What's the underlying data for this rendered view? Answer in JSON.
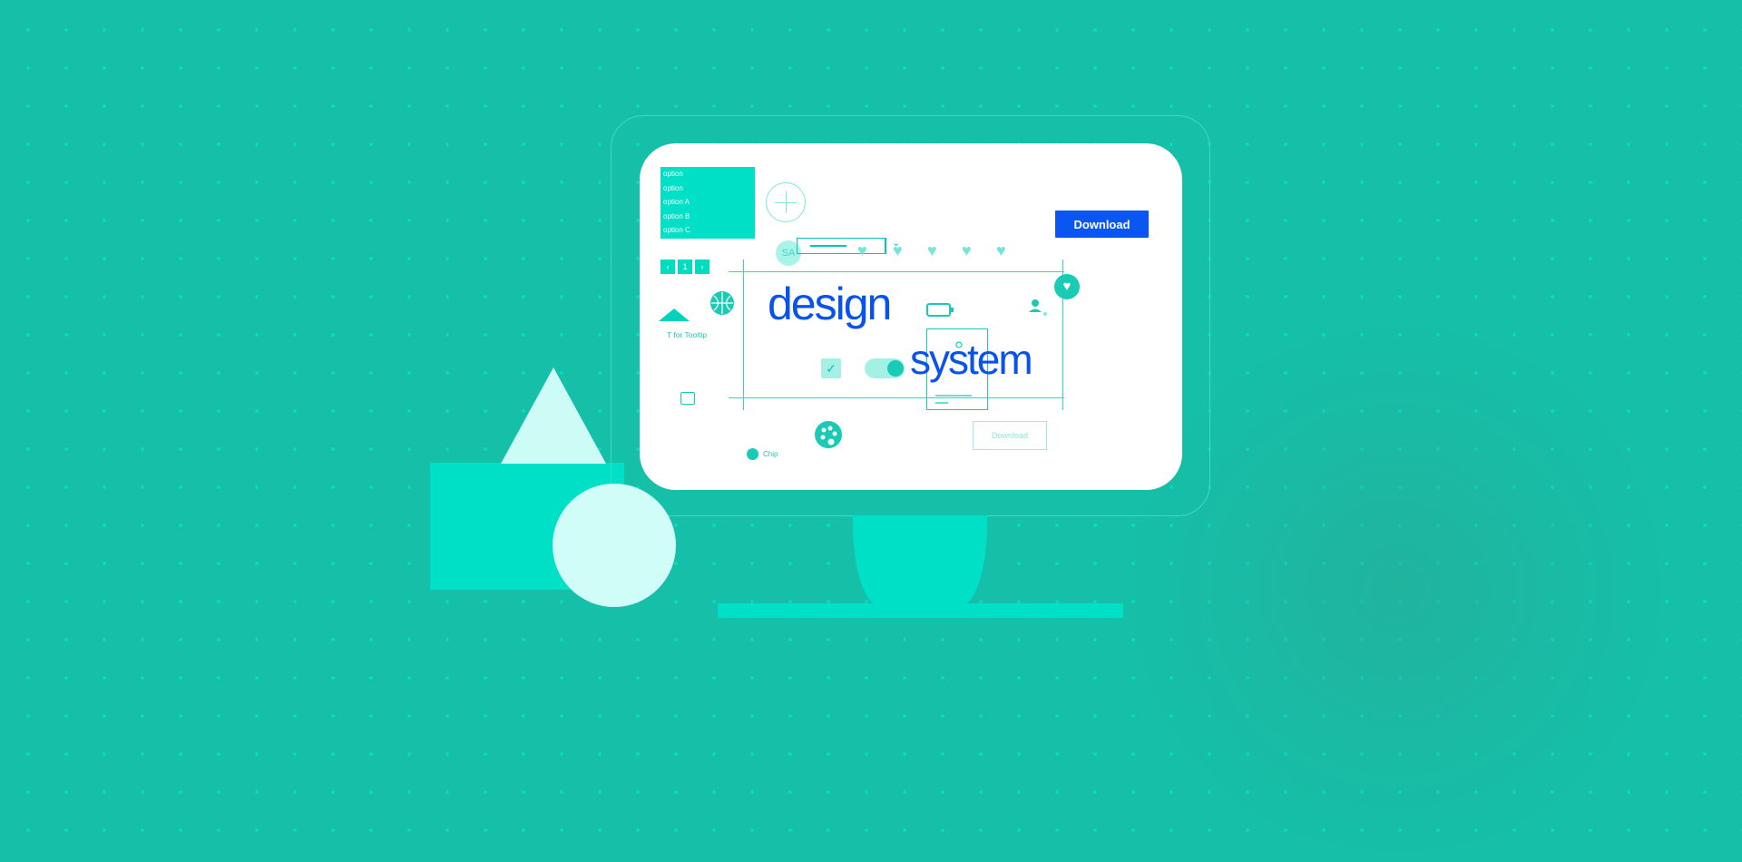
{
  "select_list": {
    "items": [
      "option",
      "option",
      "option A",
      "option B",
      "option C"
    ]
  },
  "avatar": {
    "text": "SA"
  },
  "buttons": {
    "download_primary": "Download",
    "download_outline": "Download"
  },
  "pager": {
    "prev": "‹",
    "current": "1",
    "next": "›"
  },
  "headline": {
    "word1": "design",
    "word2": "system"
  },
  "tooltip": {
    "label": "T for Tooltip"
  },
  "chip": {
    "label": "Chip"
  },
  "colors": {
    "background": "#16bfa8",
    "accent": "#00e0c6",
    "brand_blue": "#0a56f2",
    "screen": "#ffffff"
  },
  "icons": [
    "plus-icon",
    "heart-icon",
    "basketball-icon",
    "battery-icon",
    "person-icon",
    "heart-badge-icon",
    "checkbox-icon",
    "toggle-icon",
    "image-icon",
    "palette-icon",
    "chip-icon",
    "triangle-icon"
  ]
}
